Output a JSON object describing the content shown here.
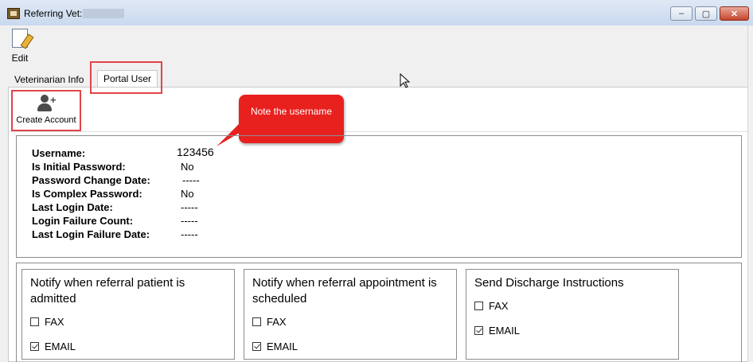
{
  "window": {
    "title": "Referring Vet:",
    "controls": {
      "minimize": "–",
      "maximize": "▢",
      "close": "✕"
    }
  },
  "toolbar": {
    "edit_label": "Edit"
  },
  "tabs": [
    {
      "label": "Veterinarian Info"
    },
    {
      "label": "Portal User"
    }
  ],
  "portal": {
    "create_account_label": "Create Account",
    "callout_text": "Note the username",
    "fields": [
      {
        "label": "Username:",
        "value": "123456"
      },
      {
        "label": "Is Initial Password:",
        "value": "No"
      },
      {
        "label": "Password Change Date:",
        "value": "-----"
      },
      {
        "label": "Is Complex Password:",
        "value": "No"
      },
      {
        "label": "Last Login Date:",
        "value": "-----"
      },
      {
        "label": "Login Failure Count:",
        "value": "-----"
      },
      {
        "label": "Last Login Failure Date:",
        "value": "-----"
      }
    ]
  },
  "notifications": [
    {
      "title": "Notify when referral patient is admitted",
      "options": [
        {
          "label": "FAX",
          "checked": false
        },
        {
          "label": "EMAIL",
          "checked": true
        }
      ]
    },
    {
      "title": "Notify when referral appointment is scheduled",
      "options": [
        {
          "label": "FAX",
          "checked": false
        },
        {
          "label": "EMAIL",
          "checked": true
        }
      ]
    },
    {
      "title": "Send Discharge Instructions",
      "options": [
        {
          "label": "FAX",
          "checked": false
        },
        {
          "label": "EMAIL",
          "checked": true
        }
      ]
    }
  ],
  "colors": {
    "highlight": "#e0454a",
    "callout": "#e8211f"
  },
  "icons": {
    "edit": "edit-document-icon",
    "create": "add-user-icon"
  }
}
